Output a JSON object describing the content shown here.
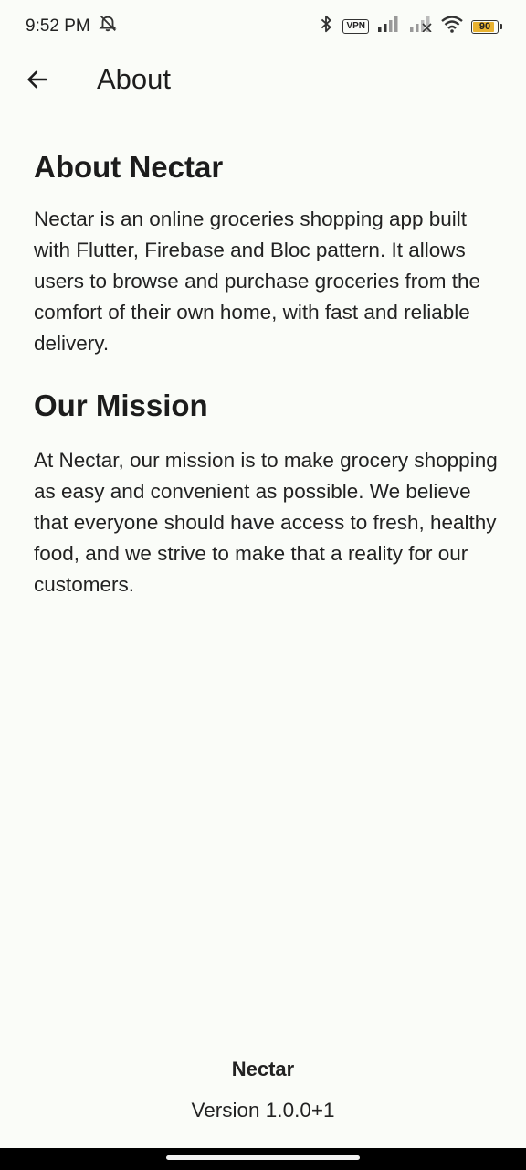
{
  "status_bar": {
    "time": "9:52 PM",
    "vpn_label": "VPN",
    "battery_level": "90",
    "battery_fraction": 0.9,
    "icons": [
      "muted-alarm-icon",
      "bluetooth-icon",
      "vpn-icon",
      "signal-icon",
      "signal-no-service-icon",
      "wifi-icon",
      "battery-icon"
    ]
  },
  "app_bar": {
    "back_icon": "arrow-left-icon",
    "title": "About"
  },
  "sections": {
    "about": {
      "heading": "About Nectar",
      "body": "Nectar is an online groceries shopping app built with Flutter, Firebase and Bloc pattern. It allows users to browse and purchase groceries from the comfort of their own home, with fast and reliable delivery."
    },
    "mission": {
      "heading": "Our Mission",
      "body": "At Nectar, our mission is to make grocery shopping as easy and convenient as possible. We believe that everyone should have access to fresh, healthy food, and we strive to make that a reality for our customers."
    }
  },
  "footer": {
    "app_name": "Nectar",
    "version": "Version 1.0.0+1"
  },
  "colors": {
    "background": "#fafcf8",
    "text": "#1c1c1c",
    "battery_fill": "#e8b230"
  }
}
